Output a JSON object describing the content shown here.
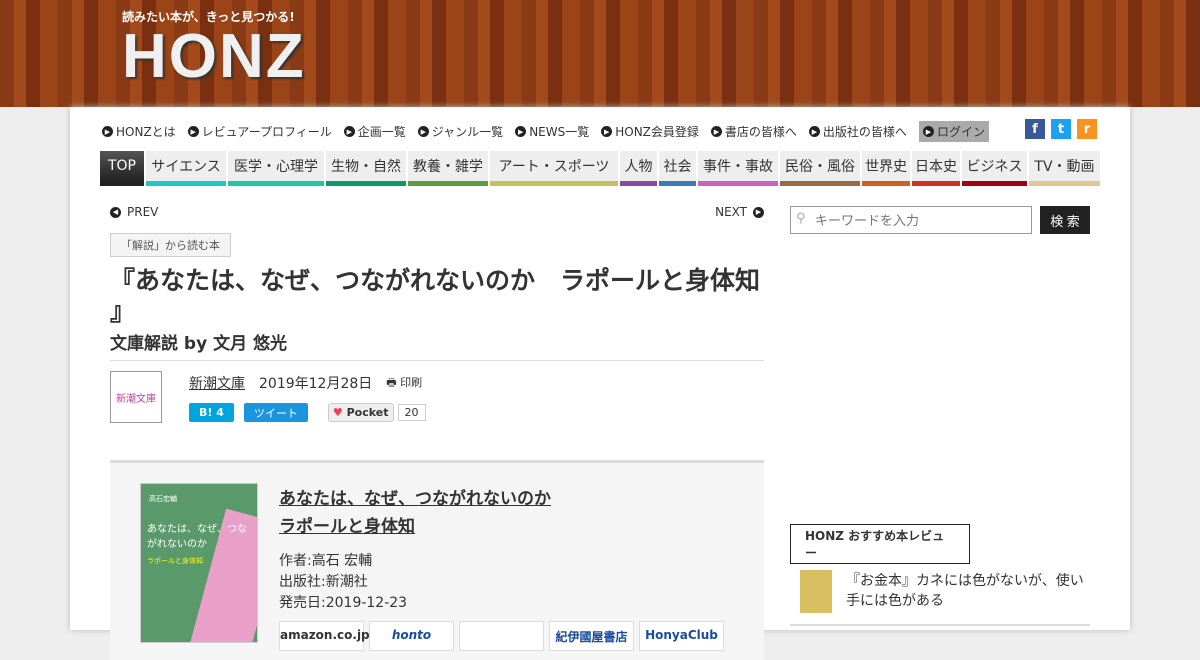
{
  "header": {
    "tagline": "読みたい本が、きっと見つかる!",
    "logo": "HONZ"
  },
  "toplinks": [
    "HONZとは",
    "レビュアープロフィール",
    "企画一覧",
    "ジャンル一覧",
    "NEWS一覧",
    "HONZ会員登録",
    "書店の皆様へ",
    "出版社の皆様へ",
    "ログイン"
  ],
  "social": {
    "facebook": "f",
    "twitter": "t",
    "rss": "r"
  },
  "nav": [
    {
      "label": "TOP",
      "color": "#222222",
      "w": 44
    },
    {
      "label": "サイエンス",
      "color": "#1ec8c8",
      "w": 80
    },
    {
      "label": "医学・心理学",
      "color": "#1ec8a0",
      "w": 96
    },
    {
      "label": "生物・自然",
      "color": "#0a9a6a",
      "w": 80
    },
    {
      "label": "教養・雑学",
      "color": "#5a9a40",
      "w": 80
    },
    {
      "label": "アート・スポーツ",
      "color": "#c8c060",
      "w": 128
    },
    {
      "label": "人物",
      "color": "#8a4aa0",
      "w": 37
    },
    {
      "label": "社会",
      "color": "#3a7ab8",
      "w": 37
    },
    {
      "label": "事件・事故",
      "color": "#c864c0",
      "w": 80
    },
    {
      "label": "民俗・風俗",
      "color": "#9a6a40",
      "w": 80
    },
    {
      "label": "世界史",
      "color": "#d06020",
      "w": 48
    },
    {
      "label": "日本史",
      "color": "#d03020",
      "w": 48
    },
    {
      "label": "ビジネス",
      "color": "#a00010",
      "w": 65
    },
    {
      "label": "TV・動画",
      "color": "#e0c890",
      "w": 71
    }
  ],
  "article": {
    "prev": "PREV",
    "next": "NEXT",
    "category": "「解説」から読む本",
    "title": "『あなたは、なぜ、つながれないのか　ラポールと身体知 』",
    "subtitle": "文庫解説 by 文月 悠光",
    "publisher_logo": "新潮文庫",
    "publisher": "新潮文庫",
    "date": "2019年12月28日",
    "print": "印刷",
    "hatena": "B! 4",
    "tweet": "ツイート",
    "pocket": "Pocket",
    "pocket_count": "20"
  },
  "book": {
    "title_line1": "あなたは、なぜ、つながれないのか",
    "title_line2": "ラポールと身体知",
    "author": "作者:高石 宏輔",
    "publisher": "出版社:新潮社",
    "release": "発売日:2019-12-23",
    "cover_author": "高石宏輔",
    "cover_title": "あなたは、なぜ、つながれないのか",
    "cover_sub": "ラポールと身体知",
    "shops": [
      "amazon.co.jp",
      "honto",
      "",
      "紀伊國屋書店",
      "HonyaClub"
    ]
  },
  "sidebar": {
    "search_placeholder": "キーワードを入力",
    "search_button": "検 索",
    "review_heading": "HONZ おすすめ本レビュー",
    "review_item": "『お金本』カネには色がないが、使い手には色がある"
  }
}
